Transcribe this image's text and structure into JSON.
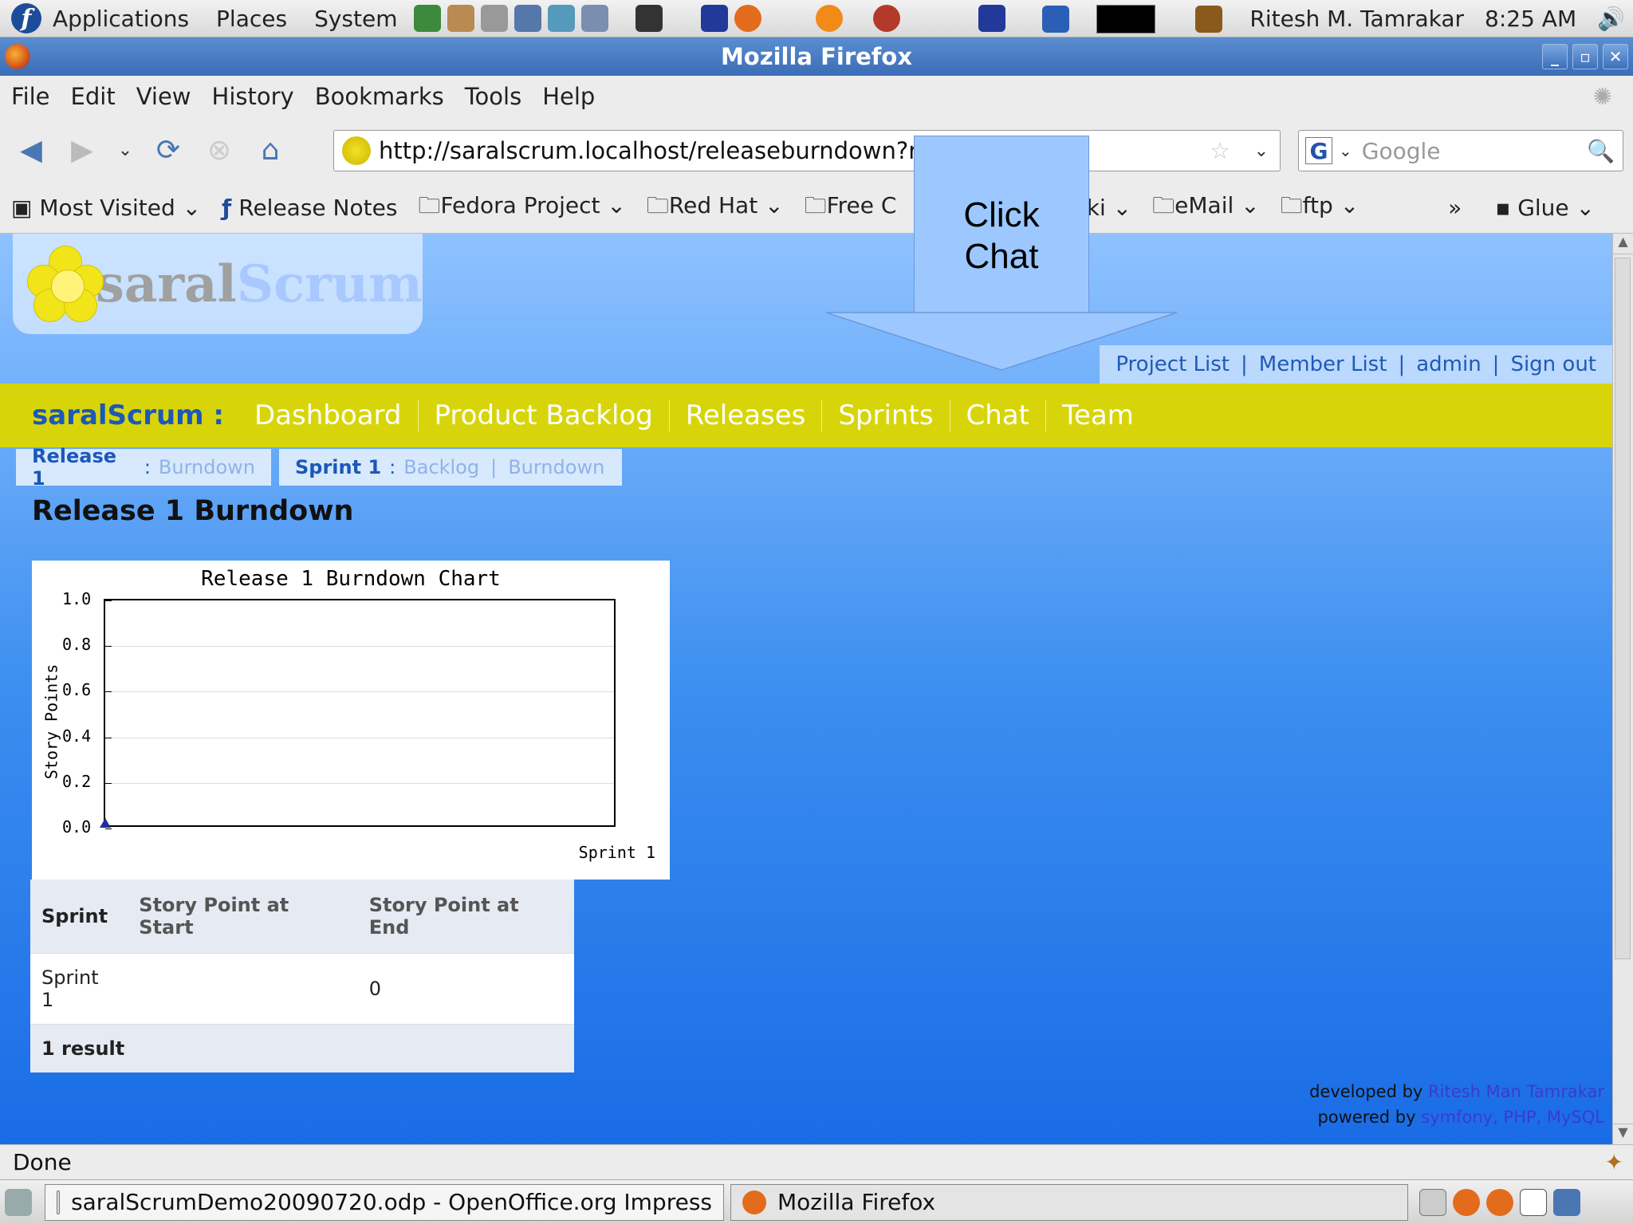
{
  "system_panel": {
    "menus": [
      "Applications",
      "Places",
      "System"
    ],
    "user": "Ritesh M. Tamrakar",
    "time": "8:25 AM"
  },
  "window": {
    "title": "Mozilla Firefox"
  },
  "menubar": [
    "File",
    "Edit",
    "View",
    "History",
    "Bookmarks",
    "Tools",
    "Help"
  ],
  "navigation": {
    "url": "http://saralscrum.localhost/releaseburndown?relea",
    "search_placeholder": "Google"
  },
  "bookmarks": [
    "Most Visited",
    "Release Notes",
    "Fedora Project",
    "Red Hat",
    "Free C",
    "Viki",
    "eMail",
    "ftp",
    "»",
    "Glue"
  ],
  "app": {
    "logo_part1": "saral",
    "logo_part2": "Scrum",
    "top_links": [
      "Project List",
      "Member List",
      "admin",
      "Sign out"
    ],
    "brand": "saralScrum :",
    "main_nav": [
      "Dashboard",
      "Product Backlog",
      "Releases",
      "Sprints",
      "Chat",
      "Team"
    ],
    "subnav_release": {
      "title": "Release 1",
      "sep": ":",
      "links": [
        "Burndown"
      ]
    },
    "subnav_sprint": {
      "title": "Sprint 1",
      "sep": ":",
      "links": [
        "Backlog",
        "Burndown"
      ]
    },
    "page_title": "Release 1 Burndown"
  },
  "chart_data": {
    "type": "line",
    "title": "Release 1 Burndown Chart",
    "ylabel": "Story Points",
    "xlabel": "",
    "categories": [
      "Sprint 1"
    ],
    "series": [
      {
        "values": [
          0
        ]
      }
    ],
    "ylim": [
      0.0,
      1.0
    ],
    "yticks": [
      "1.0",
      "0.8",
      "0.6",
      "0.4",
      "0.2",
      "0.0"
    ],
    "grid": true
  },
  "table": {
    "headers": [
      "Sprint",
      "Story Point at Start",
      "Story Point at End"
    ],
    "rows": [
      [
        "Sprint 1",
        "",
        "0"
      ]
    ],
    "footer": "1 result"
  },
  "footer": {
    "developed_label": "developed by",
    "developer": "Ritesh Man Tamrakar",
    "powered_label": "powered by",
    "powered": "symfony, PHP, MySQL"
  },
  "callout": {
    "line1": "Click",
    "line2": "Chat"
  },
  "status": "Done",
  "taskbar": {
    "tasks": [
      "saralScrumDemo20090720.odp - OpenOffice.org Impress",
      "Mozilla Firefox"
    ]
  },
  "colors": {
    "nav_bar": "#d7d50a",
    "brand_blue": "#1c57b9",
    "callout_fill": "#9cc8ff"
  }
}
